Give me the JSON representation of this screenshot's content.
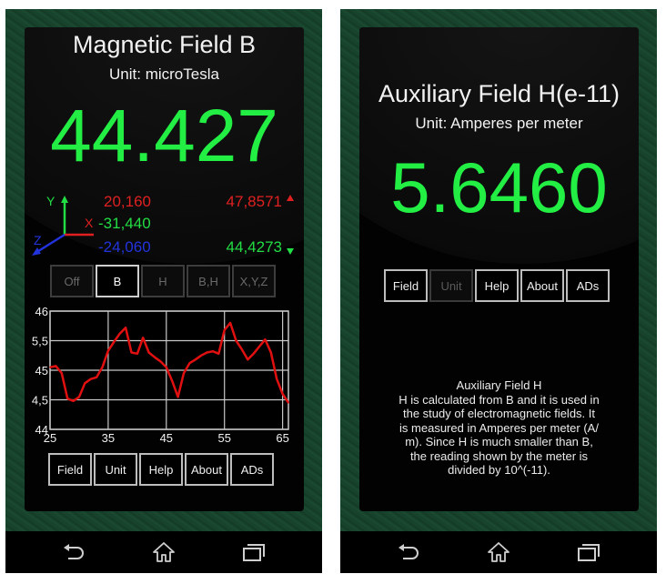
{
  "left_screen": {
    "title": "Magnetic Field B",
    "unit_label": "Unit: microTesla",
    "reading": "44.427",
    "axes": {
      "y_label": "Y",
      "x_label": "X",
      "z_label": "Z",
      "x_value": "20,160",
      "y_value": "-31,440",
      "z_value": "-24,060"
    },
    "range": {
      "max": "47,8571",
      "min": "44,4273"
    },
    "mode_buttons": [
      {
        "label": "Off",
        "active": false
      },
      {
        "label": "B",
        "active": true
      },
      {
        "label": "H",
        "active": false
      },
      {
        "label": "B,H",
        "active": false
      },
      {
        "label": "X,Y,Z",
        "active": false
      }
    ],
    "menu_buttons": [
      {
        "label": "Field",
        "enabled": true
      },
      {
        "label": "Unit",
        "enabled": true
      },
      {
        "label": "Help",
        "enabled": true
      },
      {
        "label": "About",
        "enabled": true
      },
      {
        "label": "ADs",
        "enabled": true
      }
    ]
  },
  "right_screen": {
    "title": "Auxiliary Field H(e-11)",
    "unit_label": "Unit: Amperes per meter",
    "reading": "5.6460",
    "menu_buttons": [
      {
        "label": "Field",
        "enabled": true
      },
      {
        "label": "Unit",
        "enabled": false
      },
      {
        "label": "Help",
        "enabled": true
      },
      {
        "label": "About",
        "enabled": true
      },
      {
        "label": "ADs",
        "enabled": true
      }
    ],
    "description": {
      "heading": "Auxiliary Field H",
      "lines": [
        "H is calculated from B and it is used in",
        "the study of electromagnetic fields. It",
        "is measured in Amperes per meter (A/",
        "m). Since H is much smaller than B,",
        "the reading shown by the meter is",
        "divided by 10^(-11)."
      ]
    }
  },
  "navbar": {
    "icons": [
      "back-icon",
      "home-icon",
      "recent-apps-icon"
    ]
  },
  "colors": {
    "reading_green": "#22ee44",
    "x_red": "#e02020",
    "y_green": "#22dd44",
    "z_blue": "#2233dd",
    "plot_line": "#e01010"
  },
  "chart_data": {
    "type": "line",
    "title": "",
    "xlabel": "",
    "ylabel": "",
    "xlim": [
      25,
      66
    ],
    "ylim": [
      44,
      46
    ],
    "x_ticks": [
      25,
      35,
      45,
      55,
      65
    ],
    "x_tick_labels": [
      "25",
      "35",
      "45",
      "55",
      "65"
    ],
    "y_ticks": [
      44,
      44.5,
      45,
      45.5,
      46
    ],
    "y_tick_labels": [
      "44",
      "4,5",
      "45",
      "5,5",
      "46"
    ],
    "grid": true,
    "series": [
      {
        "name": "B",
        "color": "#e01010",
        "x": [
          25,
          26,
          27,
          28,
          29,
          30,
          31,
          32,
          33,
          34,
          35,
          36,
          37,
          38,
          39,
          40,
          41,
          42,
          43,
          44,
          45,
          46,
          47,
          48,
          49,
          50,
          51,
          52,
          53,
          54,
          55,
          56,
          57,
          58,
          59,
          60,
          61,
          62,
          63,
          64,
          65,
          66
        ],
        "values": [
          45.05,
          45.07,
          44.95,
          44.52,
          44.48,
          44.55,
          44.78,
          44.85,
          44.88,
          45.05,
          45.33,
          45.48,
          45.62,
          45.72,
          45.3,
          45.28,
          45.55,
          45.3,
          45.22,
          45.15,
          45.05,
          44.82,
          44.55,
          44.95,
          45.12,
          45.18,
          45.25,
          45.3,
          45.32,
          45.28,
          45.68,
          45.8,
          45.5,
          45.35,
          45.18,
          45.28,
          45.4,
          45.52,
          45.3,
          44.85,
          44.6,
          44.45
        ]
      }
    ]
  }
}
